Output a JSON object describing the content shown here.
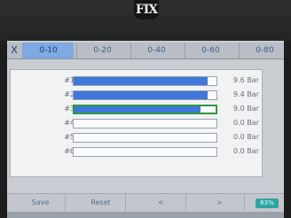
{
  "device": {
    "logo": "FIX"
  },
  "tabs": [
    {
      "label": "0-10",
      "active": true
    },
    {
      "label": "0-20",
      "active": false
    },
    {
      "label": "0-40",
      "active": false
    },
    {
      "label": "0-60",
      "active": false
    },
    {
      "label": "0-80",
      "active": false
    }
  ],
  "close_label": "X",
  "rows": [
    {
      "label": "#1",
      "value": "9.6 Bar",
      "fill_fraction": 0.94,
      "selected": false
    },
    {
      "label": "#2",
      "value": "9.4 Bar",
      "fill_fraction": 0.94,
      "selected": false
    },
    {
      "label": "#3",
      "value": "9.0 Bar",
      "fill_fraction": 0.89,
      "selected": true
    },
    {
      "label": "#4",
      "value": "0.0 Bar",
      "fill_fraction": 0,
      "selected": false
    },
    {
      "label": "#5",
      "value": "0.0 Bar",
      "fill_fraction": 0,
      "selected": false
    },
    {
      "label": "#6",
      "value": "0.0 Bar",
      "fill_fraction": 0,
      "selected": false
    }
  ],
  "toolbar": {
    "save_label": "Save",
    "reset_label": "Reset",
    "prev_label": "<",
    "next_label": ">",
    "status_label": "63%"
  },
  "colors": {
    "bar_fill": "#3f77dc",
    "selected_outline": "#2f9a3c",
    "active_tab": "#7fa9e3",
    "status_badge": "#2ea5a0"
  }
}
